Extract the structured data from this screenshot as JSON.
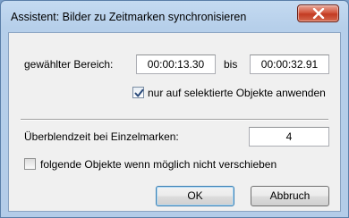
{
  "window": {
    "title": "Assistent: Bilder zu Zeitmarken synchronisieren",
    "close_icon": "close-x-icon"
  },
  "range": {
    "label": "gewählter Bereich:",
    "start_value": "00:00:13.30",
    "separator": "bis",
    "end_value": "00:00:32.91"
  },
  "selected_only": {
    "label": "nur auf selektierte Objekte anwenden",
    "checked": true
  },
  "crossfade": {
    "label": "Überblendzeit bei Einzelmarken:",
    "value": "4"
  },
  "dont_move": {
    "label": "folgende Objekte wenn möglich nicht verschieben",
    "checked": false
  },
  "buttons": {
    "ok_label": "OK",
    "cancel_label": "Abbruch"
  }
}
